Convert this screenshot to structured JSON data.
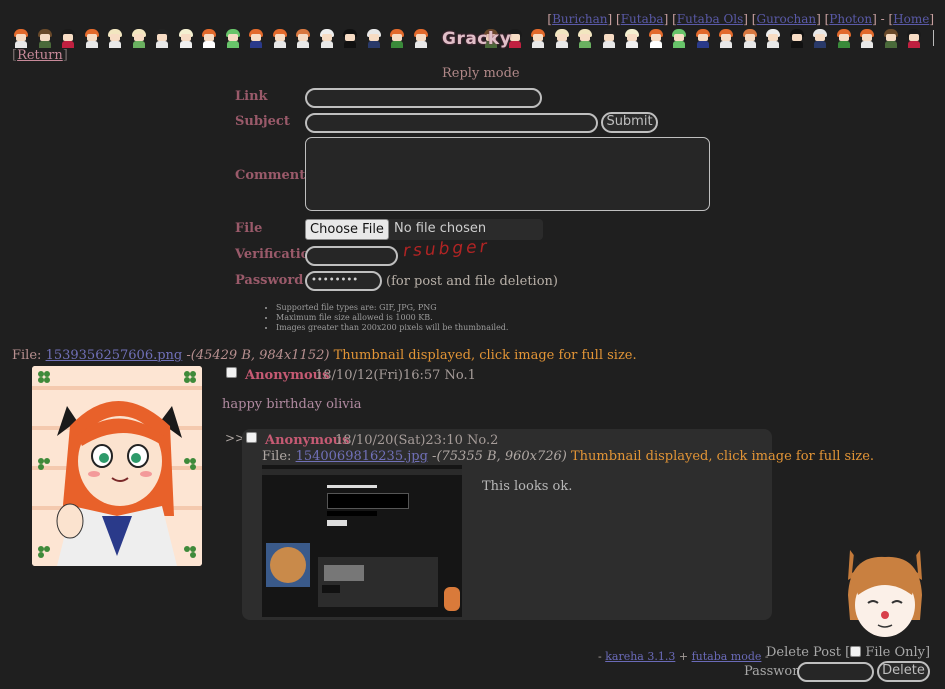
{
  "board_nav": {
    "links": [
      "Burichan",
      "Futaba",
      "Futaba Ols",
      "Gurochan",
      "Photon"
    ],
    "home": "Home"
  },
  "logo": {
    "text": "Gracky"
  },
  "return_link": "Return",
  "reply_mode": "Reply mode",
  "form": {
    "link_label": "Link",
    "subject_label": "Subject",
    "comment_label": "Comment",
    "file_label": "File",
    "verification_label": "Verification",
    "password_label": "Password",
    "submit_label": "Submit",
    "choose_file_label": "Choose File",
    "no_file_text": "No file chosen",
    "captcha_text": "rsubger",
    "password_value": "••••••••",
    "password_note": "(for post and file deletion)",
    "rules": [
      "Supported file types are: GIF, JPG, PNG",
      "Maximum file size allowed is 1000 KB.",
      "Images greater than 200x200 pixels will be thumbnailed."
    ]
  },
  "thread": {
    "op": {
      "file_prefix": "File:",
      "file_name": "1539356257606.png",
      "file_meta": "-(45429 B, 984x1152)",
      "thumb_note": "Thumbnail displayed, click image for full size.",
      "name": "Anonymous",
      "date": "18/10/12(Fri)16:57 No.1",
      "message": "happy birthday olivia"
    },
    "reply": {
      "arrows": ">>",
      "name": "Anonymous",
      "date": "18/10/20(Sat)23:10 No.2",
      "file_prefix": "File:",
      "file_name": "1540069816235.jpg",
      "file_meta": "-(75355 B, 960x726)",
      "thumb_note": "Thumbnail displayed, click image for full size.",
      "message": "This looks ok."
    }
  },
  "footer": {
    "dash1": "-",
    "kareha": "kareha 3.1.3",
    "plus": "+",
    "futaba_mode": "futaba mode",
    "dash2": "-"
  },
  "delete": {
    "label": "Delete Post [",
    "file_only": "File Only]",
    "password_label": "Password",
    "button": "Delete"
  },
  "colors": {
    "background": "#1f1f1f",
    "label": "#9a5a6a",
    "poster": "#c65a73",
    "link": "#6a6ab8",
    "orange_note": "#e39536",
    "reply_bg": "#2d2d2d"
  },
  "icons": [
    "sprite-strip-icons",
    "op-thumbnail-image",
    "reply-thumbnail-image",
    "mascot-icon"
  ]
}
